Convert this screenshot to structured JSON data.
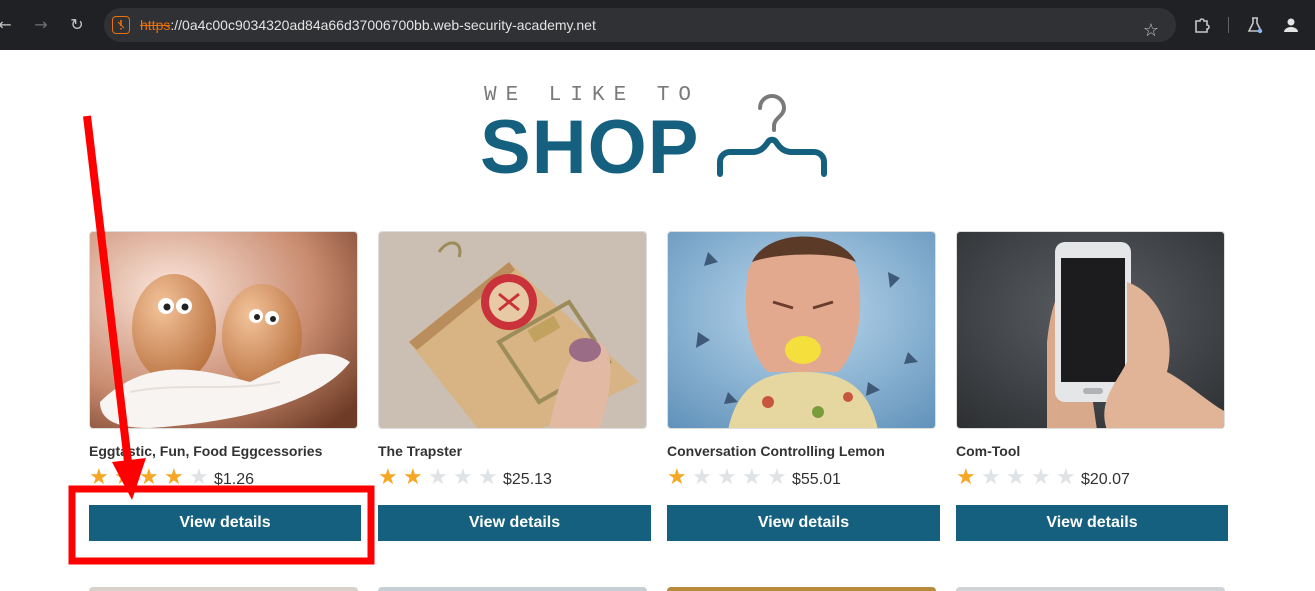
{
  "browser": {
    "url_scheme": "https",
    "url_rest": "://0a4c00c9034320ad84a66d37006700bb.web-security-academy.net",
    "icons": [
      "back-arrow-icon",
      "forward-arrow-icon",
      "reload-icon",
      "not-secure-icon",
      "bookmark-star-icon",
      "extensions-icon",
      "labs-flask-icon",
      "profile-icon"
    ]
  },
  "logo": {
    "tagline": "WE LIKE TO",
    "word": "SHOP"
  },
  "colors": {
    "brand": "#16607f",
    "star_on": "#f5a623",
    "star_off": "#dfe3e6",
    "annotation": "#ff0000"
  },
  "products": [
    {
      "title": "Eggtastic, Fun, Food Eggcessories",
      "rating": 4,
      "price": "$1.26",
      "button": "View details",
      "image": "eggs-photo"
    },
    {
      "title": "The Trapster",
      "rating": 2,
      "price": "$25.13",
      "button": "View details",
      "image": "mousetrap-photo"
    },
    {
      "title": "Conversation Controlling Lemon",
      "rating": 1,
      "price": "$55.01",
      "button": "View details",
      "image": "lemon-face-photo"
    },
    {
      "title": "Com-Tool",
      "rating": 1,
      "price": "$20.07",
      "button": "View details",
      "image": "smartphone-photo"
    }
  ]
}
